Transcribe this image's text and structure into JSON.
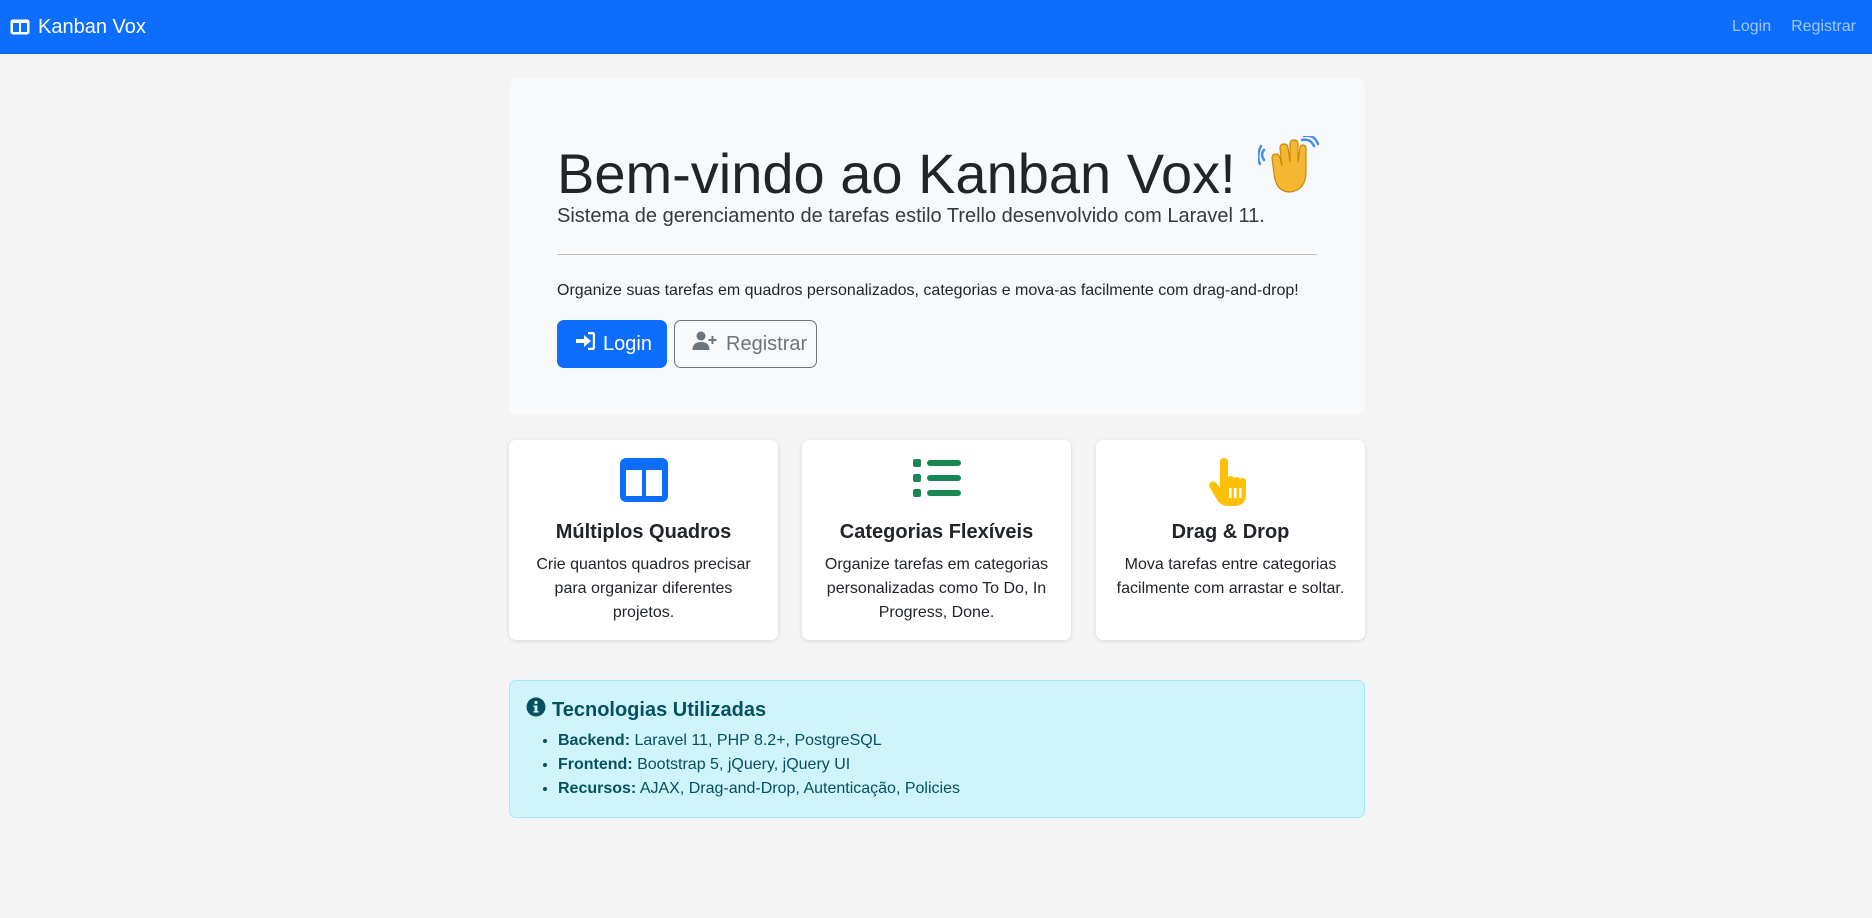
{
  "navbar": {
    "brand": "Kanban Vox",
    "brand_icon": "columns-icon",
    "links": [
      "Login",
      "Registrar"
    ]
  },
  "hero": {
    "title": "Bem-vindo ao Kanban Vox!",
    "title_emoji": "👋",
    "subtitle": "Sistema de gerenciamento de tarefas estilo Trello desenvolvido com Laravel 11.",
    "text": "Organize suas tarefas em quadros personalizados, categorias e mova-as facilmente com drag-and-drop!",
    "login_button": "Login",
    "register_button": "Registrar"
  },
  "features": [
    {
      "icon": "columns-icon",
      "title": "Múltiplos Quadros",
      "description": "Crie quantos quadros precisar para organizar diferentes projetos."
    },
    {
      "icon": "list-icon",
      "title": "Categorias Flexíveis",
      "description": "Organize tarefas em categorias personalizadas como To Do, In Progress, Done."
    },
    {
      "icon": "hand-pointer-icon",
      "title": "Drag & Drop",
      "description": "Mova tarefas entre categorias facilmente com arrastar e soltar."
    }
  ],
  "info": {
    "title": "Tecnologias Utilizadas",
    "items": [
      {
        "label": "Backend:",
        "value": "Laravel 11, PHP 8.2+, PostgreSQL"
      },
      {
        "label": "Frontend:",
        "value": "Bootstrap 5, jQuery, jQuery UI"
      },
      {
        "label": "Recursos:",
        "value": "AJAX, Drag-and-Drop, Autenticação, Policies"
      }
    ]
  },
  "colors": {
    "primary": "#0d6efd",
    "success": "#198754",
    "warning": "#ffc107",
    "info_bg": "#cff4fc",
    "info_text": "#055160"
  }
}
